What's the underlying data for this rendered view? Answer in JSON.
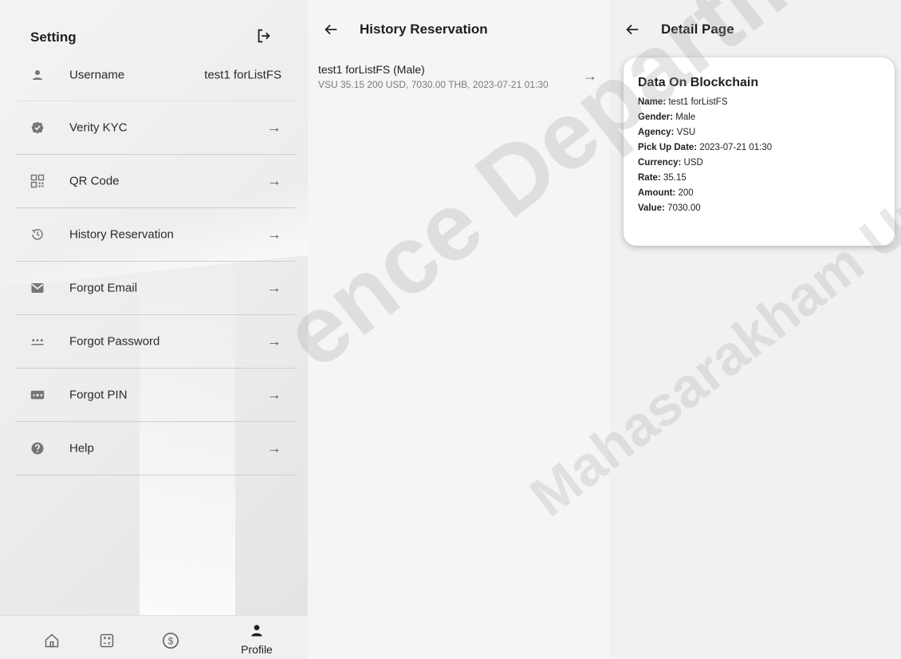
{
  "settings": {
    "title": "Setting",
    "logout_icon": "logout-icon",
    "items": [
      {
        "icon": "person-icon",
        "label": "Username",
        "value": "test1 forListFS",
        "arrow": ""
      },
      {
        "icon": "verified-badge-icon",
        "label": "Verity KYC",
        "value": "",
        "arrow": "→"
      },
      {
        "icon": "qr-code-icon",
        "label": "QR Code",
        "value": "",
        "arrow": "→"
      },
      {
        "icon": "history-icon",
        "label": "History Reservation",
        "value": "",
        "arrow": "→"
      },
      {
        "icon": "mail-icon",
        "label": "Forgot Email",
        "value": "",
        "arrow": "→"
      },
      {
        "icon": "password-icon",
        "label": "Forgot Password",
        "value": "",
        "arrow": "→"
      },
      {
        "icon": "pin-icon",
        "label": "Forgot PIN",
        "value": "",
        "arrow": "→"
      },
      {
        "icon": "help-icon",
        "label": "Help",
        "value": "",
        "arrow": "→"
      }
    ]
  },
  "bottom_nav": {
    "items": [
      {
        "icon": "home-icon",
        "label": ""
      },
      {
        "icon": "calculator-icon",
        "label": ""
      },
      {
        "icon": "dollar-icon",
        "label": ""
      },
      {
        "icon": "profile-icon",
        "label": "Profile"
      }
    ],
    "active": "Profile"
  },
  "history": {
    "back_icon": "back-arrow-icon",
    "title": "History Reservation",
    "items": [
      {
        "title": "test1 forListFS (Male)",
        "subtitle": "VSU 35.15 200 USD, 7030.00 THB, 2023-07-21 01:30",
        "arrow": "→"
      }
    ]
  },
  "detail": {
    "back_icon": "back-arrow-icon",
    "title": "Detail Page",
    "card_title": "Data On Blockchain",
    "fields": [
      {
        "label": "Name:",
        "value": "test1 forListFS"
      },
      {
        "label": "Gender:",
        "value": "Male"
      },
      {
        "label": "Agency:",
        "value": "VSU"
      },
      {
        "label": "Pick Up Date:",
        "value": "2023-07-21 01:30"
      },
      {
        "label": "Currency:",
        "value": "USD"
      },
      {
        "label": "Rate:",
        "value": "35.15"
      },
      {
        "label": "Amount:",
        "value": "200"
      },
      {
        "label": "Value:",
        "value": "7030.00"
      }
    ]
  },
  "watermark": {
    "line1": "ence Department",
    "line2": "Mahasarakham University"
  }
}
